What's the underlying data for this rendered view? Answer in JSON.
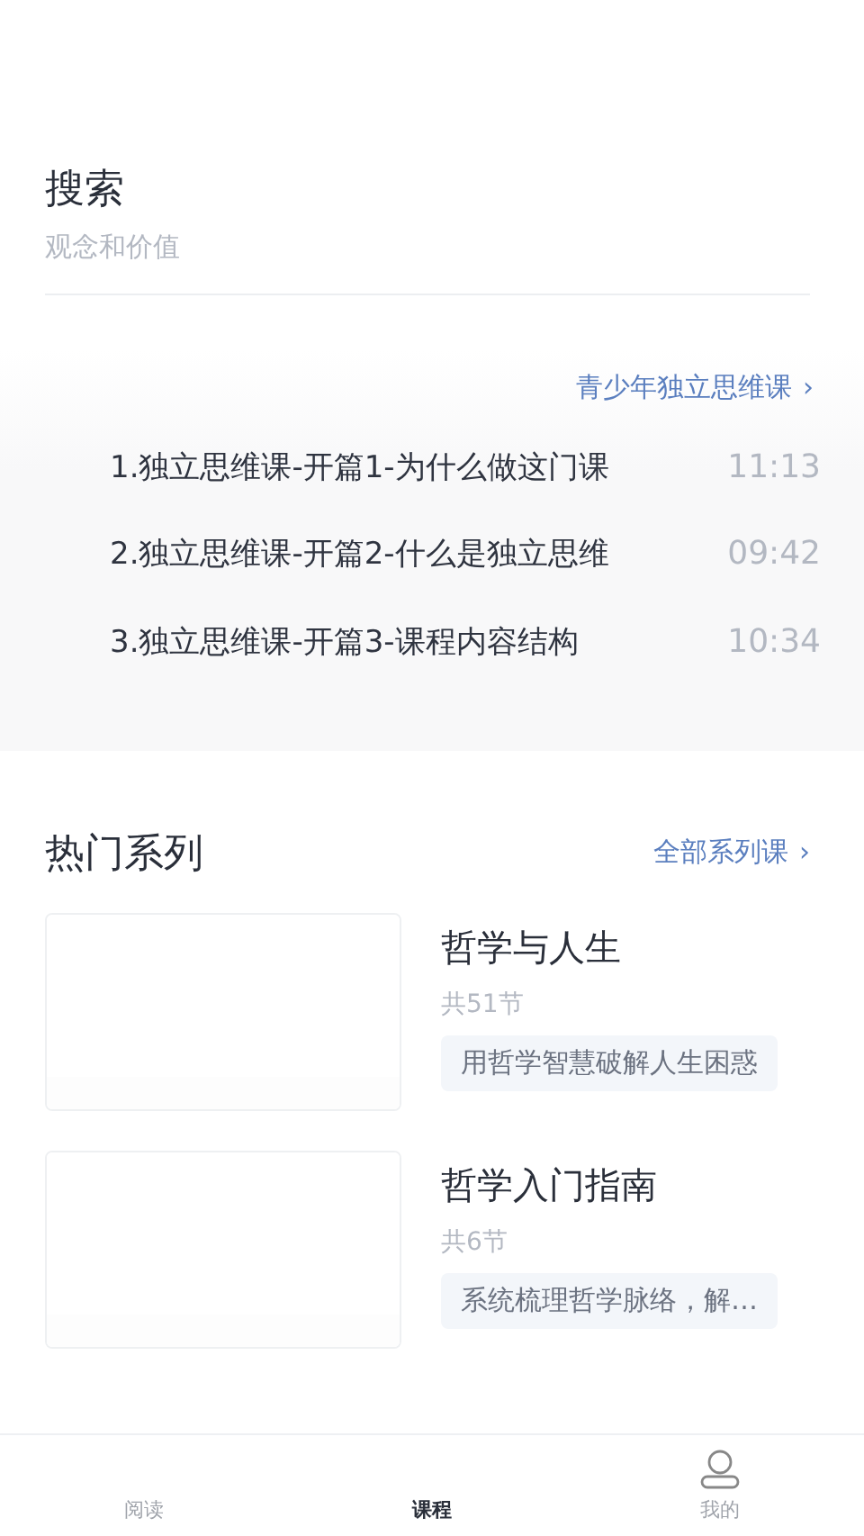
{
  "search": {
    "title": "搜索",
    "subtitle": "观念和价值"
  },
  "featured": {
    "link": "青少年独立思维课",
    "chevron": "›",
    "lessons": [
      {
        "title": "1.独立思维课-开篇1-为什么做这门课",
        "duration": "11:13"
      },
      {
        "title": "2.独立思维课-开篇2-什么是独立思维",
        "duration": "09:42"
      },
      {
        "title": "3.独立思维课-开篇3-课程内容结构",
        "duration": "10:34"
      }
    ]
  },
  "hot_series": {
    "title": "热门系列",
    "link": "全部系列课",
    "chevron": "›",
    "items": [
      {
        "kind": "picture",
        "title": "哲学与人生",
        "count": "共51节",
        "tag": "用哲学智慧破解人生困惑"
      },
      {
        "kind": "picture",
        "title": "哲学入门指南",
        "count": "共6节",
        "tag": "系统梳理哲学脉络，解…"
      }
    ]
  },
  "tab_bar": [
    {
      "label": "阅读",
      "selected": false,
      "icon": false
    },
    {
      "label": "课程",
      "selected": true,
      "icon": false
    },
    {
      "label": "我的",
      "selected": false,
      "icon": true
    }
  ]
}
